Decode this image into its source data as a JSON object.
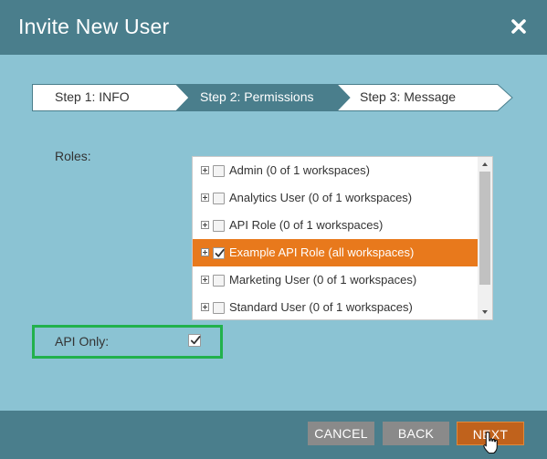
{
  "dialog": {
    "title": "Invite New User",
    "close_icon": "close-icon"
  },
  "steps": [
    {
      "label": "Step 1: INFO",
      "active": false
    },
    {
      "label": "Step 2: Permissions",
      "active": true
    },
    {
      "label": "Step 3: Message",
      "active": false
    }
  ],
  "roles": {
    "label": "Roles:",
    "items": [
      {
        "label": "Admin (0 of 1 workspaces)",
        "checked": false,
        "selected": false
      },
      {
        "label": "Analytics User (0 of 1 workspaces)",
        "checked": false,
        "selected": false
      },
      {
        "label": "API Role (0 of 1 workspaces)",
        "checked": false,
        "selected": false
      },
      {
        "label": "Example API Role (all workspaces)",
        "checked": true,
        "selected": true
      },
      {
        "label": "Marketing User (0 of 1 workspaces)",
        "checked": false,
        "selected": false
      },
      {
        "label": "Standard User (0 of 1 workspaces)",
        "checked": false,
        "selected": false
      }
    ]
  },
  "api_only": {
    "label": "API Only:",
    "checked": true
  },
  "footer": {
    "cancel_label": "CANCEL",
    "back_label": "BACK",
    "next_label": "NEXT"
  },
  "colors": {
    "title_bar": "#4a7e8c",
    "body": "#8bc3d3",
    "active_step": "#4a7e8c",
    "selected_row": "#e8791c",
    "highlight_border": "#22b14c",
    "next_button": "#c0621c",
    "secondary_button": "#8a8a8a"
  }
}
